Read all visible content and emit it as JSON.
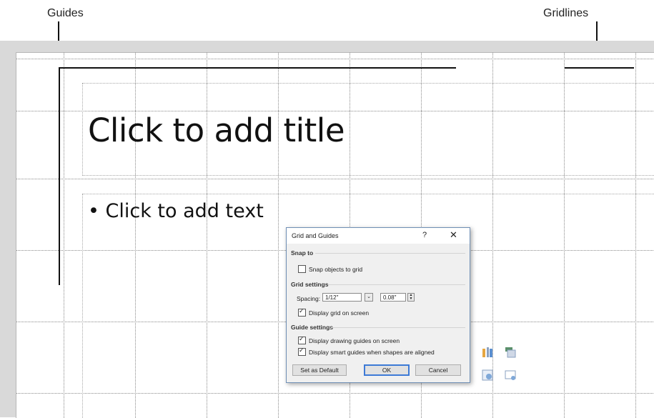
{
  "callouts": {
    "guides": "Guides",
    "gridlines": "Gridlines"
  },
  "slide": {
    "title_placeholder": "Click to add title",
    "body_placeholder": "• Click to add text"
  },
  "dialog": {
    "title": "Grid and Guides",
    "help": "?",
    "close": "✕",
    "snap_section": "Snap to",
    "snap_objects": "Snap objects to grid",
    "snap_objects_checked": false,
    "grid_section": "Grid settings",
    "spacing_label": "Spacing:",
    "spacing_value": "1/12\"",
    "spacing_number": "0.08\"",
    "display_grid": "Display grid on screen",
    "display_grid_checked": true,
    "guide_section": "Guide settings",
    "display_guides": "Display drawing guides on screen",
    "display_guides_checked": true,
    "smart_guides": "Display smart guides when shapes are aligned",
    "smart_guides_checked": true,
    "set_default": "Set as Default",
    "ok": "OK",
    "cancel": "Cancel"
  },
  "icons": [
    "layout-icon",
    "columns-icon",
    "stack-icon",
    "grid-layout-icon",
    "picture-layout-icon",
    "web-layout-icon"
  ],
  "colors": {
    "guide": "#111111",
    "dialog_border": "#6f8fb5",
    "ok_border": "#3d7ad6"
  }
}
